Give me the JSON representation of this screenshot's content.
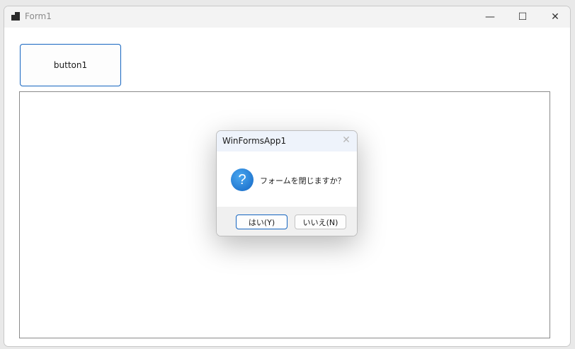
{
  "window": {
    "title": "Form1",
    "minimize_glyph": "—",
    "maximize_glyph": "☐",
    "close_glyph": "✕"
  },
  "form": {
    "button1_label": "button1"
  },
  "dialog": {
    "title": "WinFormsApp1",
    "close_glyph": "✕",
    "icon": "question-icon",
    "icon_glyph": "?",
    "message": "フォームを閉じますか？",
    "yes_label": "はい(Y)",
    "no_label": "いいえ(N)"
  },
  "colors": {
    "accent": "#1565c0",
    "dialog_titlebar": "#eef3fb",
    "question_icon": "#1a7fd8"
  }
}
